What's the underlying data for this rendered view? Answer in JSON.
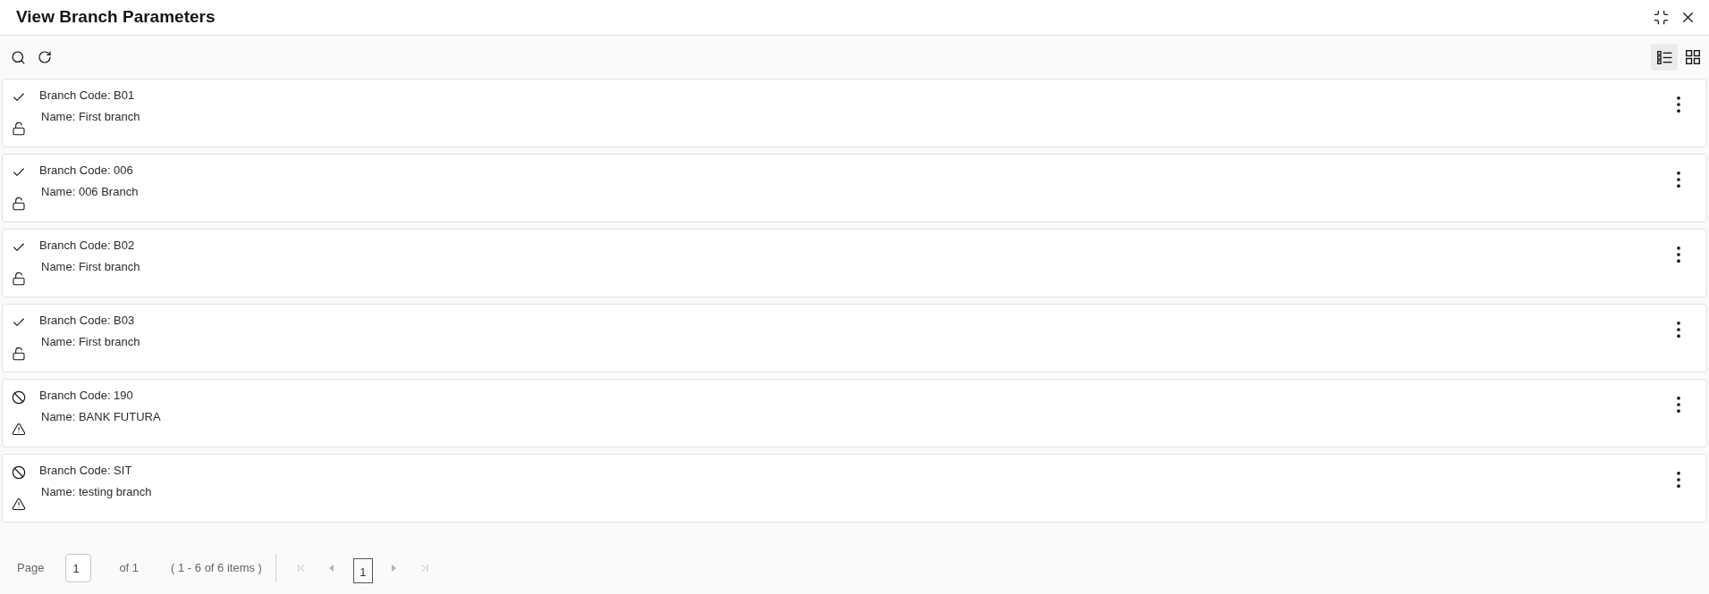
{
  "window": {
    "title": "View Branch Parameters"
  },
  "toolbar": {
    "view_modes": [
      {
        "kind": "list",
        "selected": true
      },
      {
        "kind": "grid",
        "selected": false
      }
    ]
  },
  "records": [
    {
      "code": "Branch Code: B01",
      "name": "Name: First branch",
      "authorized": true,
      "open": true
    },
    {
      "code": "Branch Code: 006",
      "name": "Name: 006 Branch",
      "authorized": true,
      "open": true
    },
    {
      "code": "Branch Code: B02",
      "name": "Name: First branch",
      "authorized": true,
      "open": true
    },
    {
      "code": "Branch Code: B03",
      "name": "Name: First branch",
      "authorized": true,
      "open": true
    },
    {
      "code": "Branch Code: 190",
      "name": "Name: BANK FUTURA",
      "authorized": false,
      "open": false
    },
    {
      "code": "Branch Code: SIT",
      "name": "Name: testing branch",
      "authorized": false,
      "open": false
    }
  ],
  "pagination": {
    "page_label": "Page",
    "page_value": "1",
    "total_pages": "of 1",
    "range": "( 1 - 6 of 6 items )",
    "nav": [
      {
        "kind": "first",
        "disabled": true
      },
      {
        "kind": "previous",
        "disabled": true
      },
      {
        "kind": "next",
        "disabled": true
      },
      {
        "kind": "last",
        "disabled": true
      }
    ],
    "pages": [
      {
        "label": "1",
        "selected": true
      }
    ]
  }
}
